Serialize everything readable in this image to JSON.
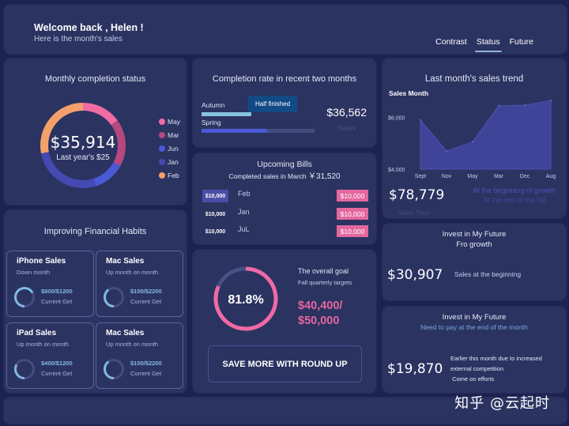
{
  "header": {
    "welcome": "Welcome back , Helen !",
    "subtitle": "Here is the month's sales",
    "tabs": [
      {
        "label": "Contrast",
        "active": false
      },
      {
        "label": "Status",
        "active": true
      },
      {
        "label": "Future",
        "active": false
      }
    ]
  },
  "monthly": {
    "title": "Monthly completion status",
    "amount": "$35,914",
    "caption": "Last year's $25",
    "segments": [
      {
        "label": "May",
        "color": "#f06aa3",
        "share": 0.15
      },
      {
        "label": "Mar",
        "color": "#b4487f",
        "share": 0.18
      },
      {
        "label": "Jun",
        "color": "#4a5ad6",
        "share": 0.12
      },
      {
        "label": "Jan",
        "color": "#4549b2",
        "share": 0.27
      },
      {
        "label": "Feb",
        "color": "#f4a06a",
        "share": 0.28
      }
    ]
  },
  "rate": {
    "title": "Completion rate in recent two months",
    "tooltip": "Half finished",
    "bars": [
      {
        "label": "Autumn",
        "progress": 0.44,
        "color": "#86c2e0",
        "track": false
      },
      {
        "label": "Spring",
        "progress": 0.58,
        "color": "#4a5ad6",
        "track": true
      }
    ],
    "amount": "$36,562",
    "amount_label": "Sales"
  },
  "bills": {
    "title": "Upcoming Bills",
    "subtitle": "Completed sales in March",
    "subtitle_value": "￥31,520",
    "rows": [
      {
        "left": "$10,000",
        "month": "Feb",
        "right": "$10,000",
        "highlight": true
      },
      {
        "left": "$10,000",
        "month": "Jan",
        "right": "$10,000",
        "highlight": false
      },
      {
        "left": "$10,000",
        "month": "JuL",
        "right": "$10,000",
        "highlight": false
      }
    ]
  },
  "trend": {
    "title": "Last month's sales trend",
    "total": "$78,779",
    "total_label": "Sales Total",
    "note1": "At the beginning of growth",
    "note2": "At the end of the fall"
  },
  "chart_data": {
    "type": "area",
    "title": "Sales Month",
    "categories": [
      "Sept",
      "Nov",
      "May",
      "Mar",
      "Dec",
      "Aug"
    ],
    "values": [
      5900,
      4700,
      5050,
      6450,
      6470,
      6650
    ],
    "yticks": [
      "$4,000",
      "$6,000"
    ],
    "ylim": [
      4000,
      6900
    ],
    "xlabel": "",
    "ylabel": "",
    "grid": false
  },
  "habits": {
    "title": "Improving Financial Habits",
    "cards": [
      {
        "name": "iPhone Sales",
        "sub": "Down month",
        "value": "$800/$1200",
        "label": "Current Get",
        "progress": 0.67
      },
      {
        "name": "Mac Sales",
        "sub": "Up month on month",
        "value": "$100/$2200",
        "label": "Current Get",
        "progress": 0.4
      },
      {
        "name": "iPad Sales",
        "sub": "Up month on month",
        "value": "$400/$1200",
        "label": "Current Get",
        "progress": 0.33
      },
      {
        "name": "Mac Sales",
        "sub": "Up month on month",
        "value": "$100/$2200",
        "label": "Current Get",
        "progress": 0.4
      }
    ]
  },
  "goal": {
    "percent_label": "81.8%",
    "progress": 0.818,
    "title": "The overall goal",
    "subtitle": "Fall  quarterly targets",
    "value_line1": "$40,400/",
    "value_line2": "$50,000",
    "button": "SAVE MORE WITH ROUND UP"
  },
  "invest1": {
    "title": "Invest in My Future",
    "subtitle": "Fro growth",
    "amount": "$30,907",
    "label": "Sales at the beginning"
  },
  "invest2": {
    "title": "Invest in My Future",
    "subtitle": "Need to pay at the end of the month",
    "amount": "$19,870",
    "lines": [
      "Earlier this month due to increased",
      "external competition",
      " Come on efforts"
    ]
  },
  "watermark": "知乎 @云起时"
}
